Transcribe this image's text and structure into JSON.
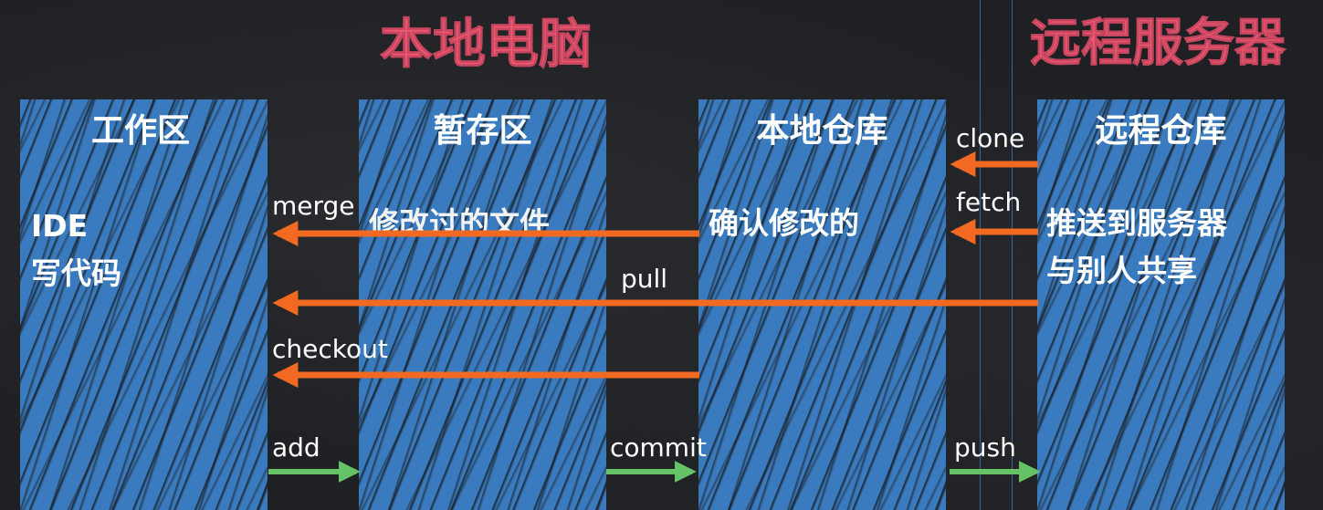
{
  "headings": {
    "local": "本地电脑",
    "remote": "远程服务器"
  },
  "columns": {
    "workspace": {
      "title": "工作区",
      "desc": "IDE\n写代码"
    },
    "staging": {
      "title": "暂存区",
      "desc": "修改过的文件"
    },
    "local_repo": {
      "title": "本地仓库",
      "desc": "确认修改的"
    },
    "remote_repo": {
      "title": "远程仓库",
      "desc": "推送到服务器\n与别人共享"
    }
  },
  "operations": {
    "clone": "clone",
    "fetch": "fetch",
    "merge": "merge",
    "pull": "pull",
    "checkout": "checkout",
    "add": "add",
    "commit": "commit",
    "push": "push"
  },
  "colors": {
    "heading": "#ef5a72",
    "column": "#3a7bbf",
    "retrieve_arrow": "#f26a21",
    "submit_arrow": "#66c266"
  },
  "flows": [
    {
      "label": "clone",
      "from": "远程仓库",
      "to": "本地仓库",
      "direction": "left"
    },
    {
      "label": "fetch",
      "from": "远程仓库",
      "to": "本地仓库",
      "direction": "left"
    },
    {
      "label": "merge",
      "from": "本地仓库",
      "to": "工作区",
      "direction": "left"
    },
    {
      "label": "pull",
      "from": "远程仓库",
      "to": "工作区",
      "direction": "left"
    },
    {
      "label": "checkout",
      "from": "本地仓库",
      "to": "工作区",
      "direction": "left"
    },
    {
      "label": "add",
      "from": "工作区",
      "to": "暂存区",
      "direction": "right"
    },
    {
      "label": "commit",
      "from": "暂存区",
      "to": "本地仓库",
      "direction": "right"
    },
    {
      "label": "push",
      "from": "本地仓库",
      "to": "远程仓库",
      "direction": "right"
    }
  ]
}
